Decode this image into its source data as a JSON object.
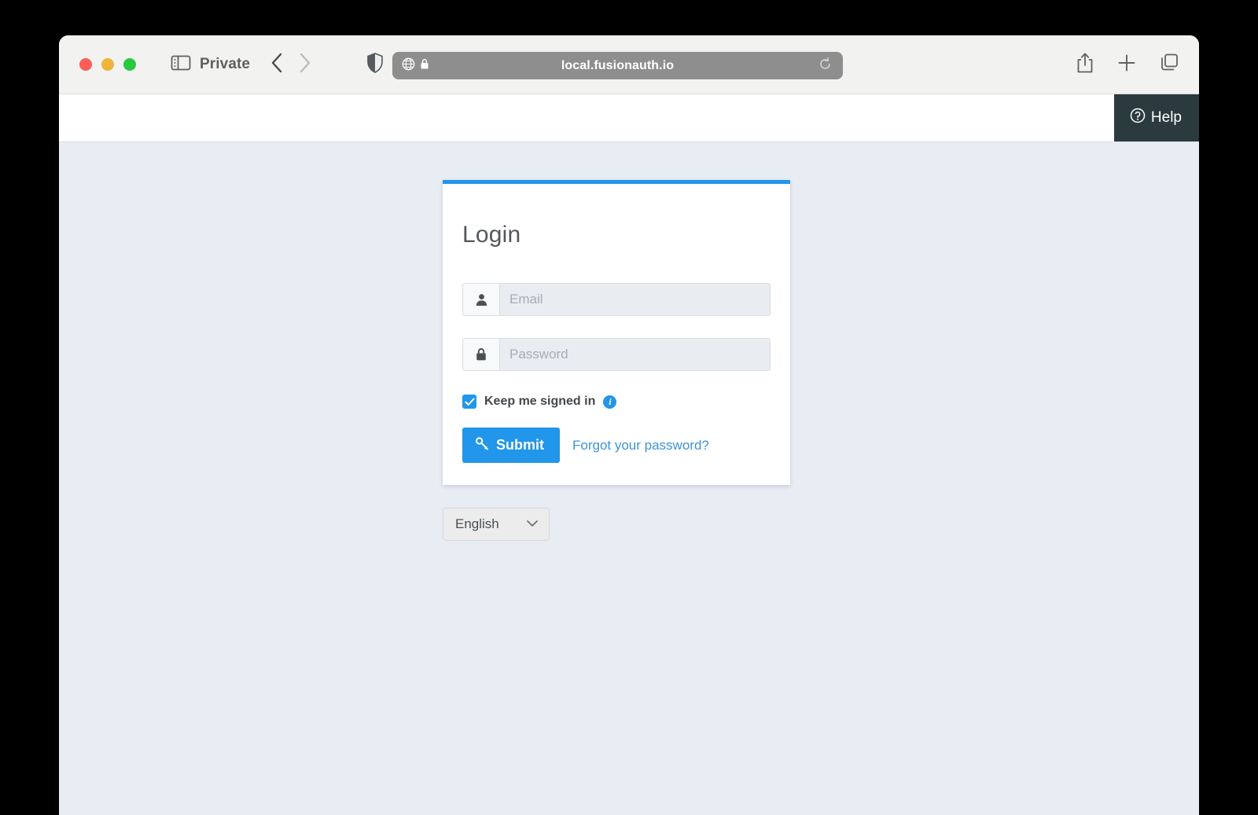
{
  "browser": {
    "sidebar_icon": "sidebar-toggle-icon",
    "private_label": "Private",
    "back_icon": "chevron-left-icon",
    "forward_icon": "chevron-right-icon",
    "shield_icon": "privacy-shield-icon",
    "url": {
      "globe_icon": "globe-icon",
      "lock_icon": "lock-icon",
      "text": "local.fusionauth.io",
      "reload_icon": "reload-icon"
    },
    "actions": {
      "share_icon": "share-icon",
      "new_tab_icon": "plus-icon",
      "tab_overview_icon": "tab-overview-icon"
    }
  },
  "page_header": {
    "help_icon": "question-circle-icon",
    "help_label": "Help"
  },
  "login": {
    "title": "Login",
    "email": {
      "icon": "user-icon",
      "placeholder": "Email",
      "value": ""
    },
    "password": {
      "icon": "lock-icon",
      "placeholder": "Password",
      "value": ""
    },
    "keep_signed_in": {
      "label": "Keep me signed in",
      "checked": true,
      "info_icon": "info-icon",
      "info_glyph": "i"
    },
    "submit": {
      "icon": "key-icon",
      "label": "Submit"
    },
    "forgot_password_label": "Forgot your password?"
  },
  "language_selector": {
    "value": "English",
    "chevron_icon": "chevron-down-icon"
  },
  "colors": {
    "accent": "#2196ea",
    "help_bar": "#2b3a3e",
    "page_background": "#e8ecf3",
    "link": "#3d95d6"
  }
}
